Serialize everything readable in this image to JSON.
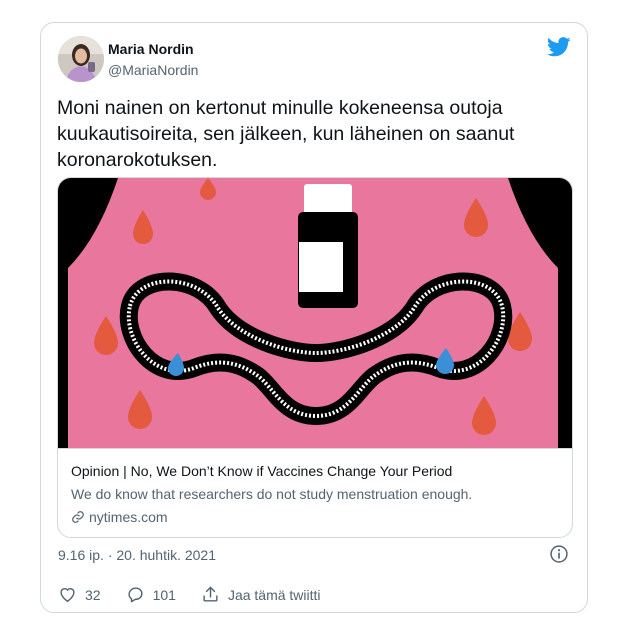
{
  "author": {
    "name": "Maria Nordin",
    "handle": "@MariaNordin"
  },
  "tweet": {
    "text": "Moni nainen on kertonut minulle kokeneensa outoja kuukautisoireita, sen jälkeen, kun läheinen on saanut koronarokotuksen."
  },
  "card": {
    "title": "Opinion | No, We Don’t Know if Vaccines Change Your Period",
    "description": "We do know that researchers do not study menstruation enough.",
    "domain": "nytimes.com",
    "image_icon": "illustration-vaccine-uterus"
  },
  "meta": {
    "timestamp": "9.16 ip. · 20. huhtik. 2021"
  },
  "actions": {
    "like_count": "32",
    "reply_count": "101",
    "share_label": "Jaa tämä twiitti"
  },
  "colors": {
    "twitter_blue": "#1d9bf0",
    "text_primary": "#0f1419",
    "text_secondary": "#536471",
    "border": "#cfd9de",
    "illustration_pink": "#e9769c",
    "illustration_red": "#e45a3f",
    "illustration_blue": "#3b8fd6"
  }
}
